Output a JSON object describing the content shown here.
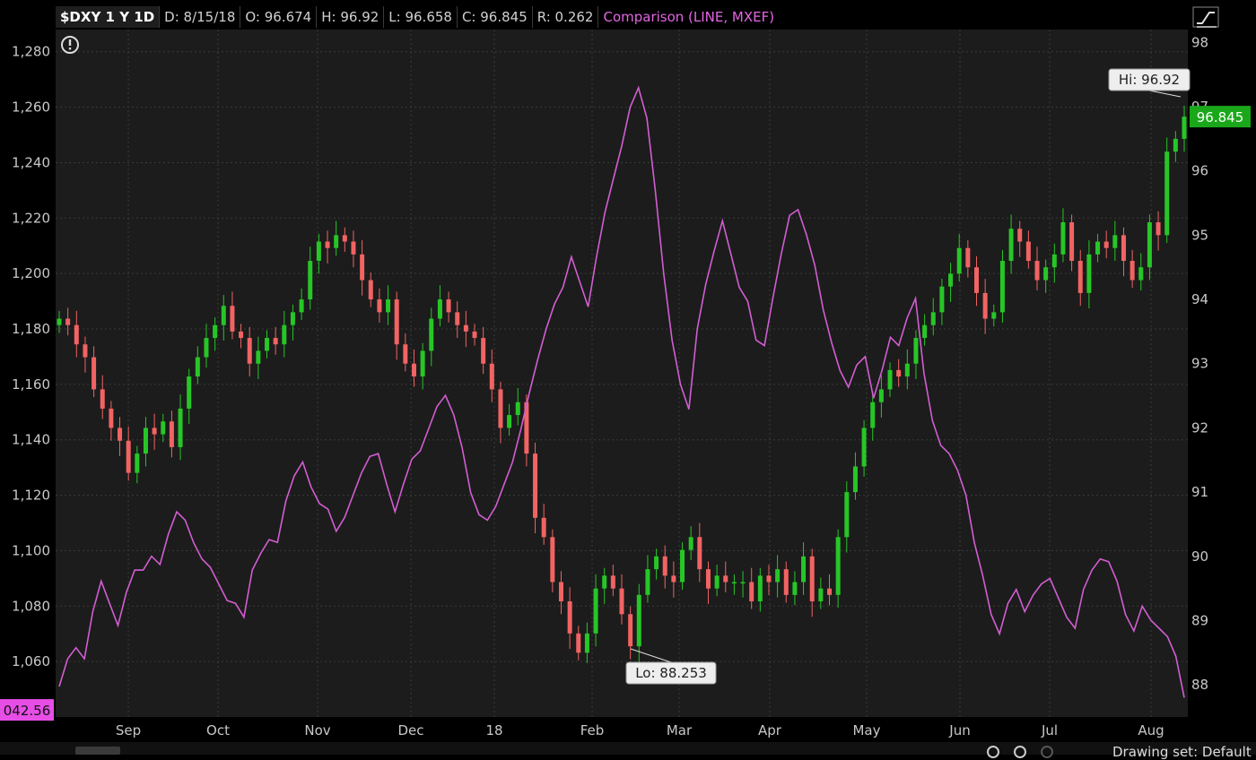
{
  "header": {
    "symbol": "$DXY 1 Y 1D",
    "date": "D: 8/15/18",
    "open": "O: 96.674",
    "high": "H: 96.92",
    "low": "L: 96.658",
    "close": "C: 96.845",
    "range": "R: 0.262",
    "comparison": "Comparison (LINE, MXEF)"
  },
  "colors": {
    "background": "#1c1c1c",
    "up": "#27c627",
    "down": "#f26363",
    "comparison": "#d25ed2",
    "price_badge": "#1aa81a",
    "left_badge": "#e64ee6"
  },
  "chart_data": {
    "type": "line",
    "x_labels": [
      "Sep",
      "Oct",
      "Nov",
      "Dec",
      "18",
      "Feb",
      "Mar",
      "Apr",
      "May",
      "Jun",
      "Jul",
      "Aug"
    ],
    "left_axis": {
      "ticks": [
        "1,060",
        "1,080",
        "1,100",
        "1,120",
        "1,140",
        "1,160",
        "1,180",
        "1,200",
        "1,220",
        "1,240",
        "1,260",
        "1,280"
      ],
      "range": [
        1040,
        1288
      ]
    },
    "right_axis": {
      "ticks": [
        "88",
        "89",
        "90",
        "91",
        "92",
        "93",
        "94",
        "95",
        "96",
        "97",
        "98"
      ],
      "range": [
        87.5,
        98.2
      ]
    },
    "grid": true,
    "series": [
      {
        "symbol": "$DXY",
        "style": "candlestick",
        "axis": "right",
        "close": [
          93.7,
          93.6,
          93.3,
          93.1,
          92.6,
          92.3,
          92.0,
          91.8,
          91.3,
          91.6,
          92.0,
          91.9,
          92.1,
          91.7,
          92.3,
          92.8,
          93.1,
          93.4,
          93.6,
          93.9,
          93.5,
          93.4,
          93.0,
          93.2,
          93.4,
          93.3,
          93.6,
          93.8,
          94.0,
          94.6,
          94.9,
          94.8,
          95.0,
          94.9,
          94.7,
          94.3,
          94.0,
          93.8,
          94.0,
          93.3,
          93.0,
          92.8,
          93.2,
          93.7,
          94.0,
          93.8,
          93.6,
          93.5,
          93.4,
          93.0,
          92.6,
          92.0,
          92.2,
          92.4,
          91.6,
          90.6,
          90.3,
          89.6,
          89.3,
          88.8,
          88.5,
          88.8,
          89.5,
          89.7,
          89.5,
          89.1,
          88.6,
          89.4,
          89.8,
          90.0,
          89.7,
          89.6,
          90.1,
          90.3,
          89.8,
          89.5,
          89.7,
          89.6,
          89.6,
          89.6,
          89.3,
          89.7,
          89.6,
          89.8,
          89.4,
          89.6,
          90.0,
          89.3,
          89.5,
          89.4,
          90.3,
          91.0,
          91.4,
          92.0,
          92.4,
          92.6,
          92.9,
          92.8,
          93.0,
          93.4,
          93.6,
          93.8,
          94.2,
          94.4,
          94.8,
          94.5,
          94.1,
          93.7,
          93.8,
          94.6,
          95.1,
          94.9,
          94.6,
          94.3,
          94.5,
          94.7,
          95.2,
          94.6,
          94.1,
          94.7,
          94.9,
          94.8,
          95.0,
          94.6,
          94.3,
          94.5,
          95.2,
          95.0,
          96.3,
          96.5,
          96.845
        ],
        "annotations": {
          "high": "Hi: 96.92",
          "low": "Lo: 88.253",
          "last": "96.845"
        }
      },
      {
        "symbol": "MXEF",
        "style": "line",
        "axis": "left",
        "values": [
          1051,
          1061,
          1065,
          1061,
          1078,
          1089,
          1081,
          1073,
          1085,
          1093,
          1093,
          1098,
          1095,
          1106,
          1114,
          1111,
          1103,
          1097,
          1094,
          1088,
          1082,
          1081,
          1076,
          1093,
          1099,
          1104,
          1103,
          1118,
          1127,
          1132,
          1123,
          1117,
          1115,
          1107,
          1112,
          1120,
          1128,
          1134,
          1135,
          1124,
          1114,
          1124,
          1133,
          1136,
          1144,
          1152,
          1156,
          1149,
          1137,
          1121,
          1113,
          1111,
          1116,
          1124,
          1132,
          1144,
          1157,
          1169,
          1180,
          1189,
          1195,
          1206,
          1197,
          1188,
          1206,
          1222,
          1234,
          1246,
          1260,
          1267,
          1256,
          1230,
          1200,
          1176,
          1160,
          1151,
          1180,
          1196,
          1208,
          1219,
          1207,
          1195,
          1190,
          1176,
          1174,
          1191,
          1207,
          1221,
          1223,
          1214,
          1203,
          1187,
          1175,
          1165,
          1159,
          1167,
          1170,
          1155,
          1165,
          1177,
          1174,
          1184,
          1191,
          1164,
          1147,
          1138,
          1135,
          1129,
          1120,
          1103,
          1091,
          1077,
          1070,
          1081,
          1086,
          1078,
          1084,
          1088,
          1090,
          1083,
          1076,
          1072,
          1086,
          1093,
          1097,
          1096,
          1089,
          1077,
          1071,
          1080,
          1075,
          1072,
          1069,
          1062,
          1047
        ]
      }
    ]
  },
  "overlays": {
    "left_badge": "042.56",
    "bottom_text": "Drawing set: Default"
  }
}
